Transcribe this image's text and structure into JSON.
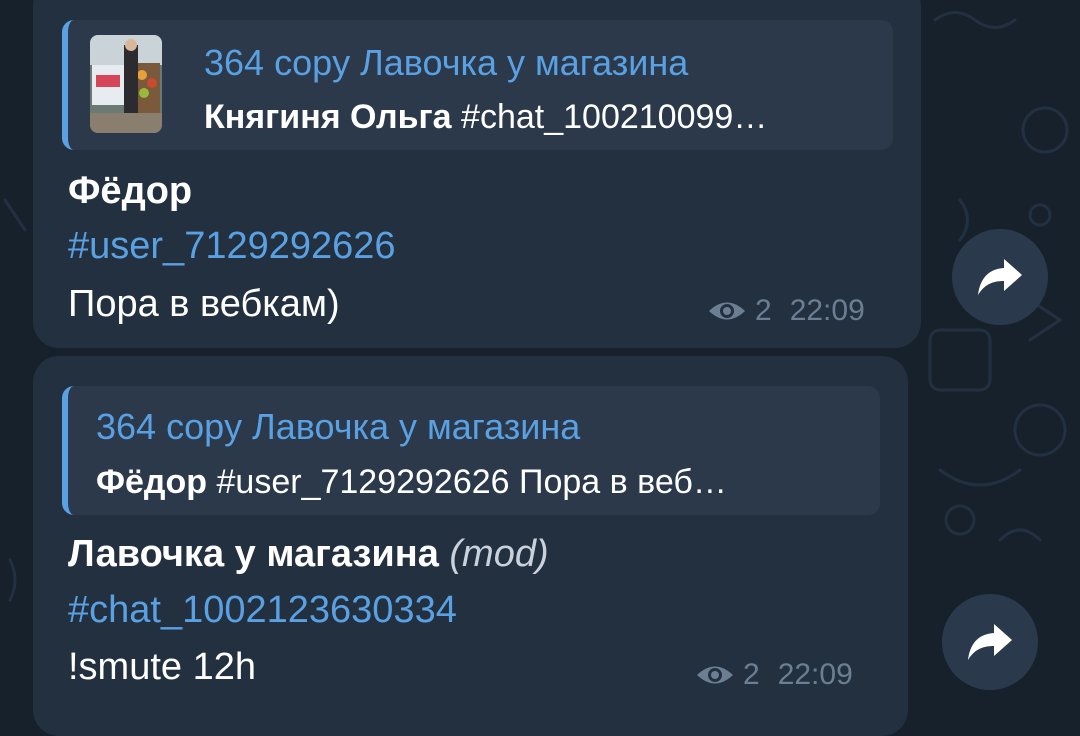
{
  "colors": {
    "background": "#17212b",
    "bubble": "#233040",
    "reply_block": "#2b394b",
    "accent": "#5aa1e3",
    "meta": "#6c7f92"
  },
  "messages": [
    {
      "reply": {
        "title": "364 copy Лавочка у магазина",
        "sender": "Княгиня Ольга",
        "text": "#chat_100210099…",
        "has_thumbnail": true
      },
      "sender": "Фёдор",
      "sender_suffix": "",
      "tag": "#user_7129292626",
      "text": "Пора в вебкам)",
      "views": "2",
      "time": "22:09",
      "icons": {
        "views": "eye-icon",
        "forward": "share-arrow-icon"
      }
    },
    {
      "reply": {
        "title": "364 copy Лавочка у магазина",
        "sender": "Фёдор",
        "text": "#user_7129292626 Пора в веб…",
        "has_thumbnail": false
      },
      "sender": "Лавочка у магазина",
      "sender_suffix": "(mod)",
      "tag": "#chat_1002123630334",
      "text": "!smute 12h",
      "views": "2",
      "time": "22:09",
      "icons": {
        "views": "eye-icon",
        "forward": "share-arrow-icon"
      }
    }
  ]
}
